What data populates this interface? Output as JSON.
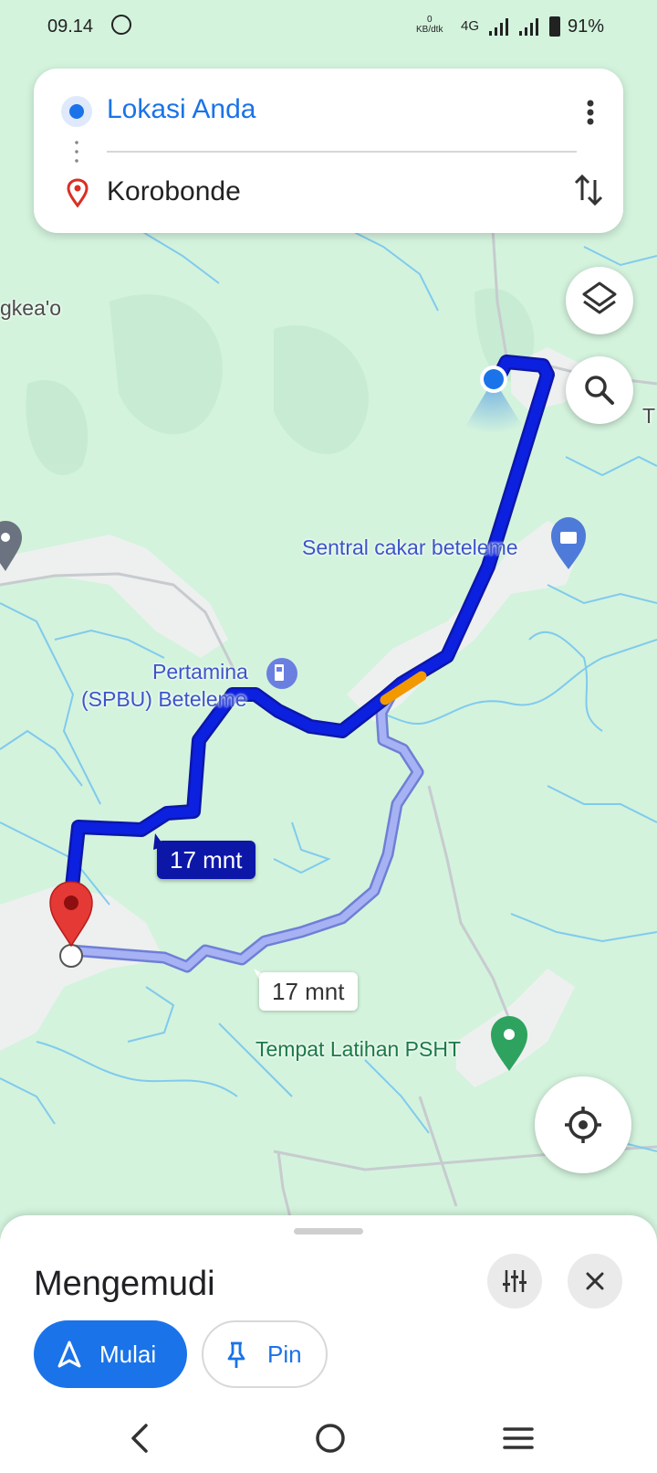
{
  "status_bar": {
    "time": "09.14",
    "speed_value": "0",
    "speed_unit": "KB/dtk",
    "network": "4G",
    "battery": "91%"
  },
  "directions": {
    "origin": "Lokasi Anda",
    "destination": "Korobonde"
  },
  "map": {
    "labels": {
      "top_left_place": "gkea'o",
      "right_edge_place": "T",
      "shop": "Sentral cakar beteleme",
      "fuel_line1": "Pertamina",
      "fuel_line2": "(SPBU) Beteleme",
      "training": "Tempat Latihan PSHT"
    },
    "route_main_eta": "17 mnt",
    "route_alt_eta": "17 mnt"
  },
  "sheet": {
    "mode_title": "Mengemudi",
    "start_label": "Mulai",
    "pin_label": "Pin"
  },
  "colors": {
    "accent": "#1a73e8",
    "route_main": "#0c17d9",
    "route_alt": "#9aa7f0",
    "map_background": "#d3f3dd",
    "water": "#7cc8ee"
  },
  "icons": [
    "whatsapp-icon",
    "signal-icon",
    "battery-icon",
    "my-location-dot-icon",
    "destination-pin-icon",
    "more-vert-icon",
    "swap-icon",
    "layers-icon",
    "search-icon",
    "shop-icon",
    "fuel-icon",
    "green-place-icon",
    "my-location-icon",
    "tune-icon",
    "close-icon",
    "navigation-arrow-icon",
    "pin-icon",
    "back-icon",
    "home-icon",
    "recents-icon"
  ]
}
